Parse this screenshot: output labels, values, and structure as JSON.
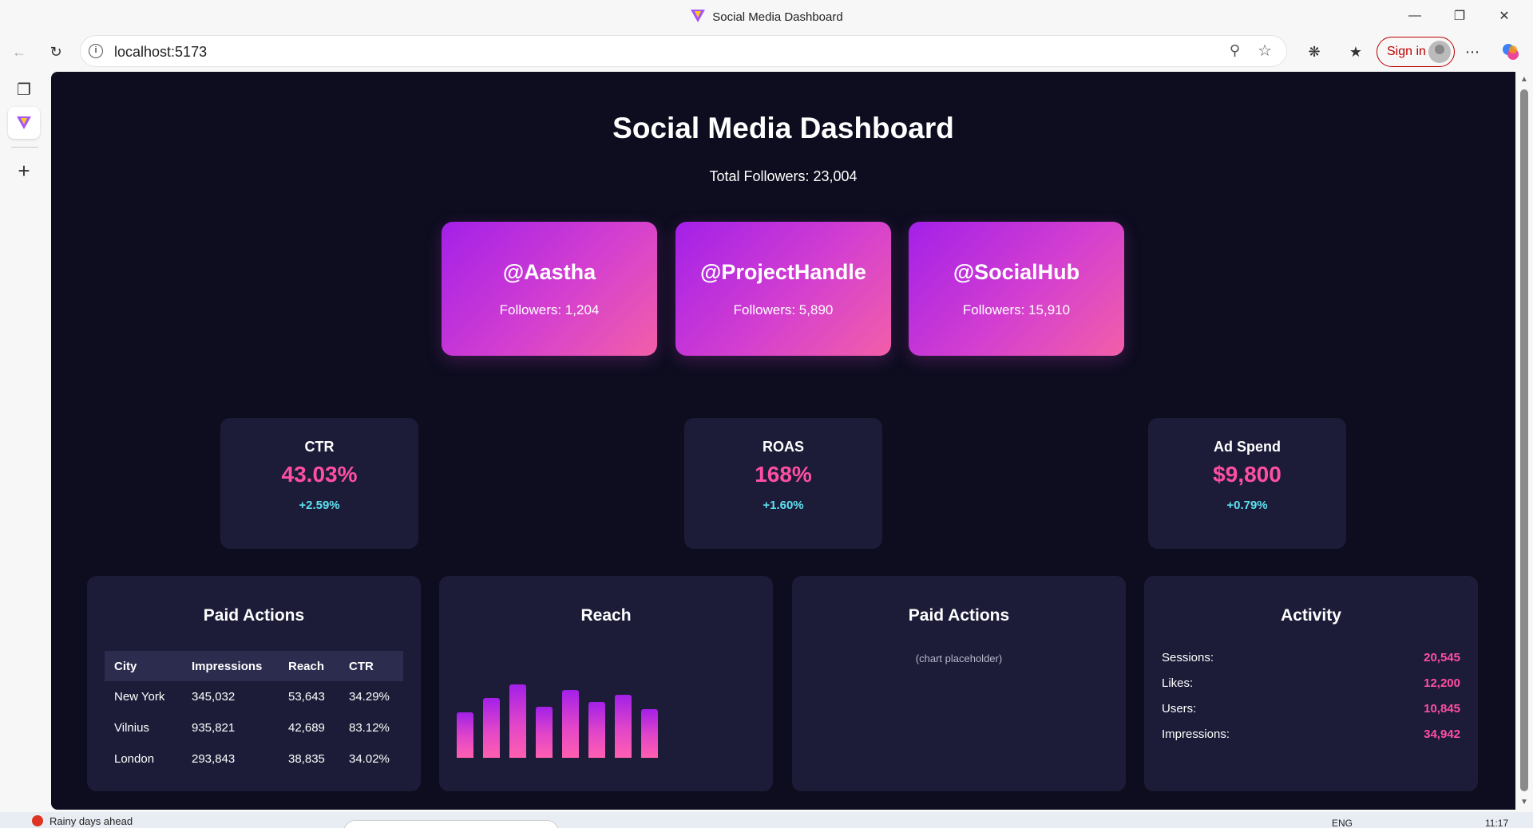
{
  "window": {
    "title": "Social Media Dashboard",
    "minimize_icon": "minimize-icon",
    "restore_icon": "restore-icon",
    "close_icon": "close-icon"
  },
  "browser": {
    "url": "localhost:5173",
    "sign_in_label": "Sign in"
  },
  "dashboard": {
    "title": "Social Media Dashboard",
    "total_followers": "Total Followers: 23,004",
    "accounts": [
      {
        "handle": "@Aastha",
        "followers": "Followers: 1,204"
      },
      {
        "handle": "@ProjectHandle",
        "followers": "Followers: 5,890"
      },
      {
        "handle": "@SocialHub",
        "followers": "Followers: 15,910"
      }
    ],
    "metrics": [
      {
        "label": "CTR",
        "value": "43.03%",
        "change": "+2.59%"
      },
      {
        "label": "ROAS",
        "value": "168%",
        "change": "+1.60%"
      },
      {
        "label": "Ad Spend",
        "value": "$9,800",
        "change": "+0.79%"
      }
    ],
    "paid_actions_table": {
      "title": "Paid Actions",
      "headers": [
        "City",
        "Impressions",
        "Reach",
        "CTR"
      ],
      "rows": [
        [
          "New York",
          "345,032",
          "53,643",
          "34.29%"
        ],
        [
          "Vilnius",
          "935,821",
          "42,689",
          "83.12%"
        ],
        [
          "London",
          "293,843",
          "38,835",
          "34.02%"
        ]
      ]
    },
    "reach_panel": {
      "title": "Reach"
    },
    "paid_actions_chart": {
      "title": "Paid Actions",
      "placeholder": "(chart placeholder)"
    },
    "activity": {
      "title": "Activity",
      "items": [
        {
          "label": "Sessions:",
          "value": "20,545"
        },
        {
          "label": "Likes:",
          "value": "12,200"
        },
        {
          "label": "Users:",
          "value": "10,845"
        },
        {
          "label": "Impressions:",
          "value": "34,942"
        }
      ]
    }
  },
  "chart_data": {
    "type": "bar",
    "title": "Reach",
    "categories": [],
    "values": [
      62,
      82,
      100,
      70,
      92,
      76,
      86,
      66
    ],
    "ylim": [
      0,
      100
    ],
    "xlabel": "",
    "ylabel": "",
    "grid": false
  },
  "taskbar": {
    "weather": "Rainy days ahead",
    "lang": "ENG",
    "clock": "11:17"
  },
  "colors": {
    "page_background": "#0d0d1f",
    "card_background": "#1c1c38",
    "accent_pink": "#ff4fa3",
    "accent_cyan": "#5ee0f0",
    "gradient_start": "#a320e8",
    "gradient_end": "#f25fa8"
  }
}
